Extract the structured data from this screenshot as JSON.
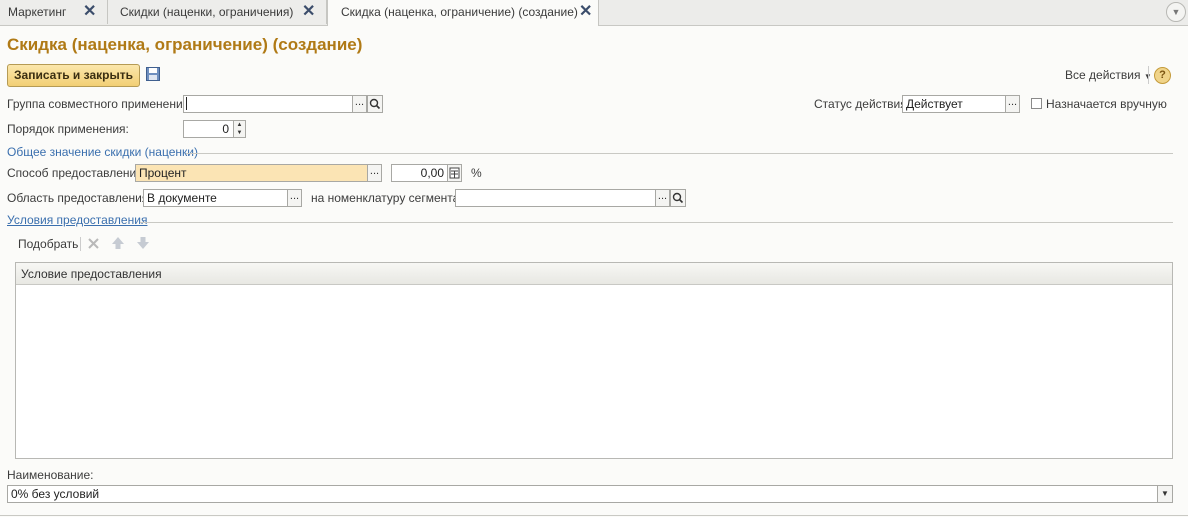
{
  "tabs": [
    {
      "label": "Маркетинг"
    },
    {
      "label": "Скидки (наценки, ограничения)"
    },
    {
      "label": "Скидка (наценка, ограничение) (создание)"
    }
  ],
  "tab_close_glyph": "✕",
  "title": "Скидка (наценка, ограничение) (создание)",
  "toolbar": {
    "save_close_label": "Записать и закрыть",
    "all_actions_label": "Все действия",
    "help_glyph": "?"
  },
  "form": {
    "group_label": "Группа совместного применения:",
    "group_value": "",
    "order_label": "Порядок применения:",
    "order_value": "0",
    "status_label": "Статус действия:",
    "status_value": "Действует",
    "manual_label": "Назначается вручную",
    "manual_checked": false,
    "section_general": "Общее значение скидки (наценки)",
    "method_label": "Способ предоставления:",
    "method_value": "Процент",
    "amount_value": "0,00",
    "percent_sign": "%",
    "area_label": "Область предоставления:",
    "area_value": "В документе",
    "segment_label": "на номенклатуру сегмента:",
    "segment_value": "",
    "conditions_link": "Условия предоставления",
    "pick_label": "Подобрать",
    "grid_header": "Условие предоставления",
    "name_label": "Наименование:",
    "name_value": "0% без условий",
    "ellipsis": "..."
  },
  "icons": {
    "search": "magnifier-icon",
    "save": "floppy-disk-icon",
    "delete": "x-delete-icon",
    "move_up": "arrow-up-icon",
    "move_down": "arrow-down-icon",
    "calculator": "calculator-icon",
    "dropdown": "triangle-down-icon"
  },
  "colors": {
    "title": "#b07a16",
    "link": "#3a6fae",
    "primary_button": "#f2cf75",
    "highlight_field": "#fbe4b4"
  }
}
